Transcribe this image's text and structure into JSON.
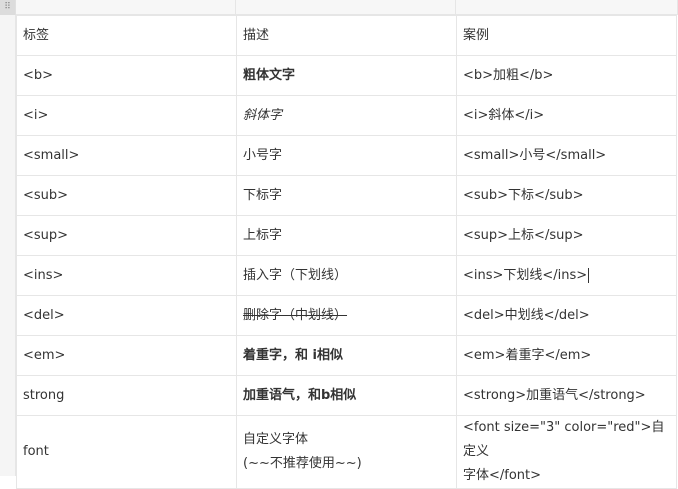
{
  "table": {
    "headers": [
      "标签",
      "描述",
      "案例"
    ],
    "rows": [
      {
        "tag": "<b>",
        "desc": "粗体文字",
        "example": "<b>加粗</b>"
      },
      {
        "tag": "<i>",
        "desc": "斜体字",
        "example": "<i>斜体</i>"
      },
      {
        "tag": "<small>",
        "desc": "小号字",
        "example": "<small>小号</small>"
      },
      {
        "tag": "<sub>",
        "desc": "下标字",
        "example": "<sub>下标</sub>"
      },
      {
        "tag": "<sup>",
        "desc": "上标字",
        "example": "<sup>上标</sup>"
      },
      {
        "tag": "<ins>",
        "desc": "插入字（下划线）",
        "example": "<ins>下划线</ins>"
      },
      {
        "tag": "<del>",
        "desc": "删除字（中划线）",
        "example": "<del>中划线</del>"
      },
      {
        "tag": "<em>",
        "desc": "着重字，和 i相似",
        "example": "<em>着重字</em>"
      },
      {
        "tag": "strong",
        "desc": "加重语气，和b相似",
        "example": "<strong>加重语气</strong>"
      },
      {
        "tag": "font",
        "desc_line1": "自定义字体",
        "desc_line2": "(~~不推荐使用~~)",
        "example_line1": "<font size=\"3\" color=\"red\">自定义",
        "example_line2": "字体</font>"
      }
    ]
  }
}
